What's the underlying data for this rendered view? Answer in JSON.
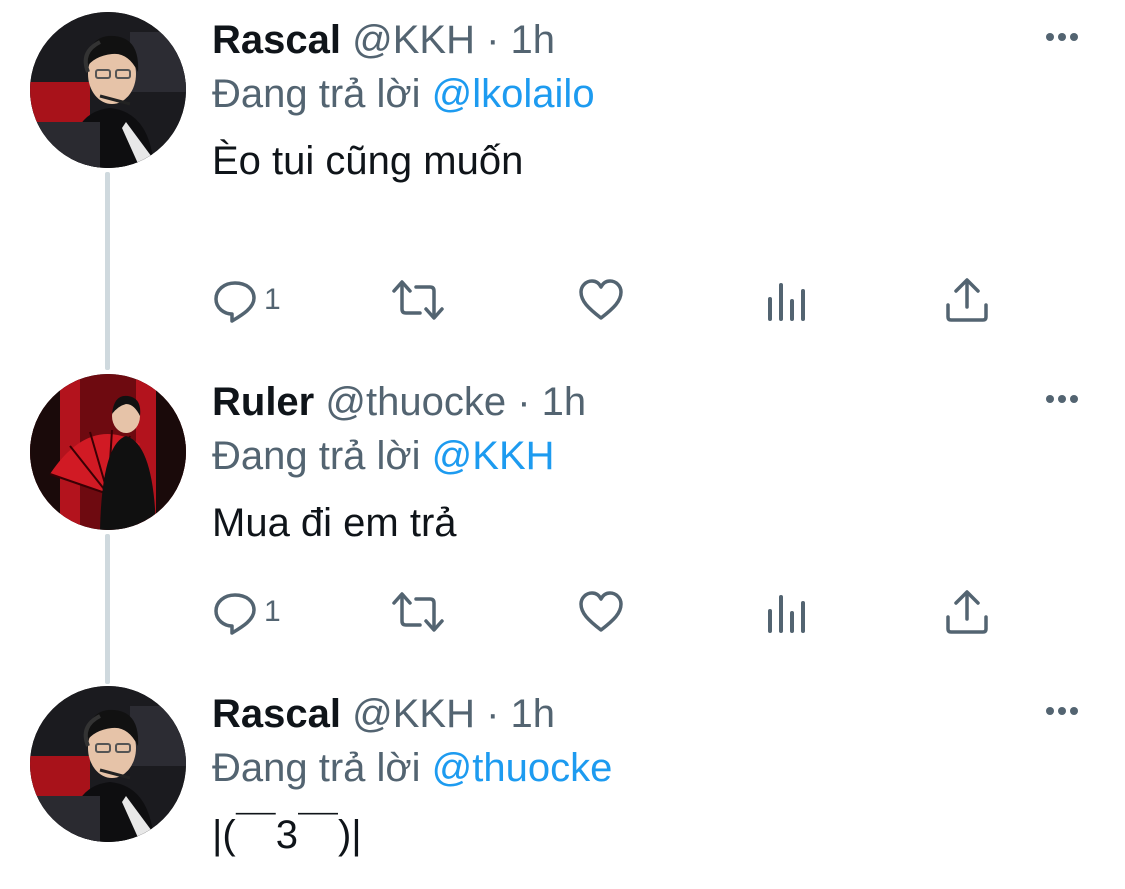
{
  "tweets": [
    {
      "name": "Rascal",
      "handle": "@KKH",
      "separator": "·",
      "time": "1h",
      "reply_prefix": "Đang trả lời",
      "reply_to": "@lkolailo",
      "text": "Èo tui cũng muốn",
      "reply_count": "1",
      "avatar": "rascal-avatar"
    },
    {
      "name": "Ruler",
      "handle": "@thuocke",
      "separator": "·",
      "time": "1h",
      "reply_prefix": "Đang trả lời",
      "reply_to": "@KKH",
      "text": "Mua đi em trả",
      "reply_count": "1",
      "avatar": "ruler-avatar"
    },
    {
      "name": "Rascal",
      "handle": "@KKH",
      "separator": "·",
      "time": "1h",
      "reply_prefix": "Đang trả lời",
      "reply_to": "@thuocke",
      "text": "|(￣3￣)|",
      "avatar": "rascal-avatar"
    }
  ],
  "icons": {
    "reply": "reply-icon",
    "retweet": "retweet-icon",
    "like": "heart-icon",
    "views": "analytics-icon",
    "share": "share-icon",
    "more": "more-icon"
  },
  "colors": {
    "text": "#0f1419",
    "muted": "#536471",
    "mention": "#1d9bf0",
    "thread_line": "#cfd9de"
  }
}
